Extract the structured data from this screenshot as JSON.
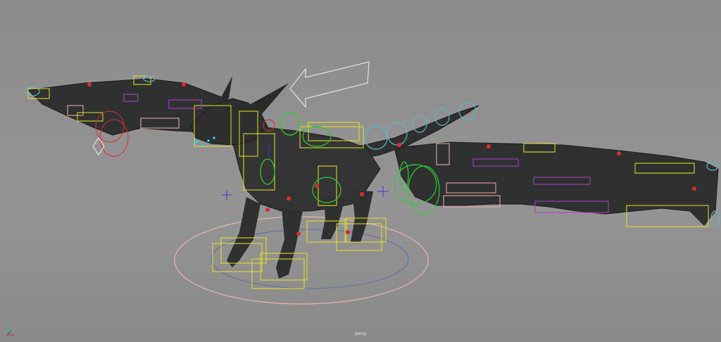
{
  "viewport": {
    "camera_name": "persp"
  },
  "colors": {
    "background": "#8f8f8f",
    "mesh_dark": "#2f3131",
    "control_yellow": "#e6e21a",
    "control_green": "#2ad02a",
    "control_cyan": "#5fb6c4",
    "control_magenta": "#b03ad0",
    "control_red": "#e02a2a",
    "control_pink": "#f2b0a8",
    "locator_blue": "#3a3ae0",
    "pointer_white": "#f0f0f0"
  },
  "icons": {
    "axis_gizmo": "xyz-axis-icon",
    "selection_arrow": "arrow-left-icon"
  }
}
